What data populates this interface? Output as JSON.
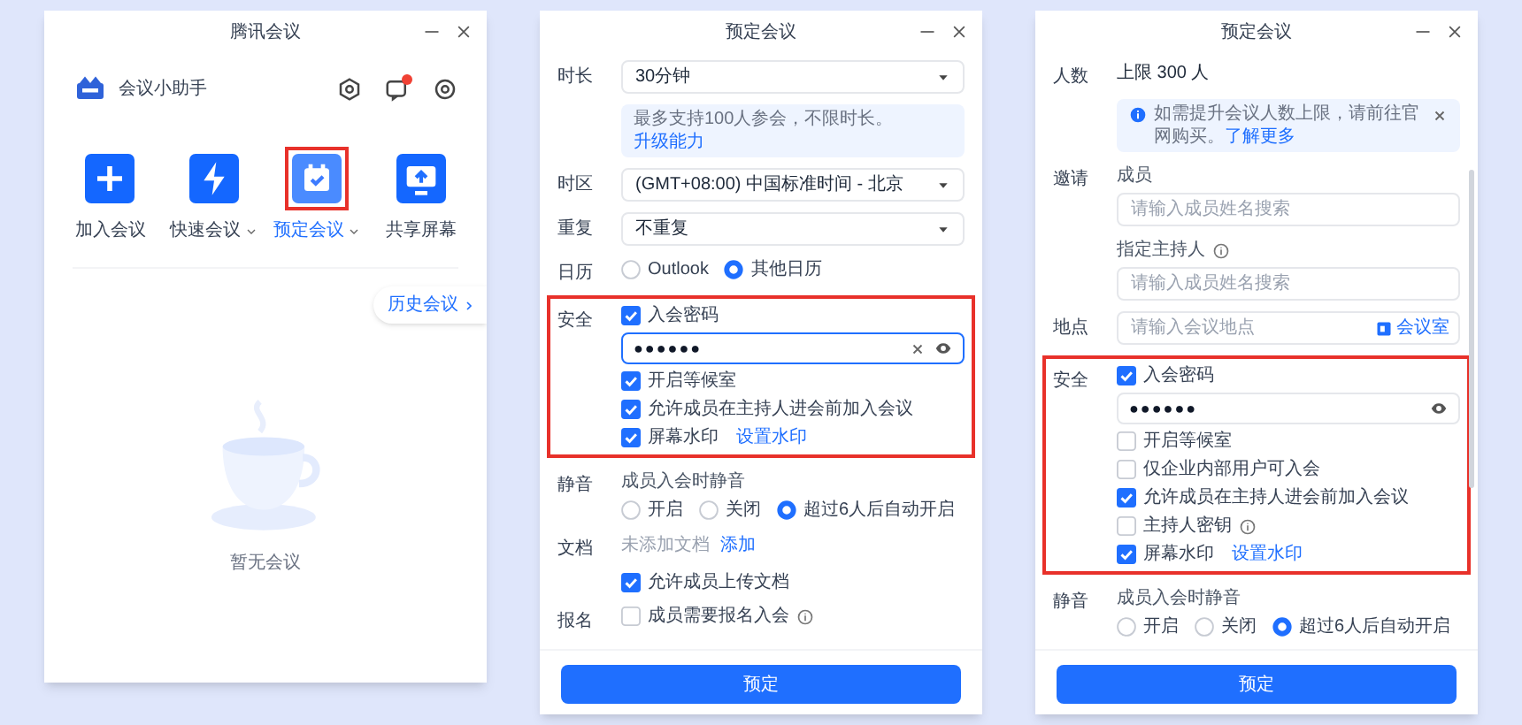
{
  "main_window": {
    "title": "腾讯会议",
    "assistant": "会议小助手",
    "notification_dot": true,
    "actions": [
      {
        "label": "加入会议",
        "selected": false
      },
      {
        "label": "快速会议",
        "dropdown": true,
        "selected": false
      },
      {
        "label": "预定会议",
        "dropdown": true,
        "selected": true
      },
      {
        "label": "共享屏幕",
        "selected": false
      }
    ],
    "history_button": "历史会议",
    "empty_text": "暂无会议"
  },
  "schedule_windows": [
    {
      "title": "预定会议",
      "rows": [
        {
          "kind": "select",
          "label": "时长",
          "value": "30分钟"
        },
        {
          "kind": "notice",
          "text": "最多支持100人参会，不限时长。",
          "link": "升级能力"
        },
        {
          "kind": "select",
          "label": "时区",
          "value": "(GMT+08:00) 中国标准时间 - 北京"
        },
        {
          "kind": "select",
          "label": "重复",
          "value": "不重复"
        },
        {
          "kind": "radios",
          "label": "日历",
          "options": [
            {
              "label": "Outlook",
              "selected": false
            },
            {
              "label": "其他日历",
              "selected": true
            }
          ]
        },
        {
          "kind": "group",
          "label": "安全",
          "highlighted": true,
          "items": [
            {
              "kind": "checkbox",
              "text": "入会密码",
              "checked": true
            },
            {
              "kind": "password",
              "value": "●●●●●●",
              "focused": true,
              "clearable": true
            },
            {
              "kind": "checkbox",
              "text": "开启等候室",
              "checked": true
            },
            {
              "kind": "checkbox",
              "text": "允许成员在主持人进会前加入会议",
              "checked": true
            },
            {
              "kind": "checkbox",
              "text": "屏幕水印",
              "checked": true,
              "link": "设置水印"
            }
          ]
        },
        {
          "kind": "radios",
          "label": "静音",
          "caption": "成员入会时静音",
          "options": [
            {
              "label": "开启",
              "selected": false
            },
            {
              "label": "关闭",
              "selected": false
            },
            {
              "label": "超过6人后自动开启",
              "selected": true
            }
          ]
        },
        {
          "kind": "doc",
          "label": "文档",
          "text": "未添加文档",
          "link": "添加"
        },
        {
          "kind": "checkbox",
          "text": "允许成员上传文档",
          "checked": true
        },
        {
          "kind": "checkbox",
          "label": "报名",
          "text": "成员需要报名入会",
          "checked": false,
          "info": true
        }
      ],
      "button": "预定"
    },
    {
      "title": "预定会议",
      "scrollbar": true,
      "rows": [
        {
          "kind": "plain",
          "label": "人数",
          "value": "上限 300 人"
        },
        {
          "kind": "alert",
          "text": "如需提升会议人数上限，请前往官网购买。",
          "link": "了解更多"
        },
        {
          "kind": "field",
          "label": "邀请",
          "caption": "成员",
          "placeholder": "请输入成员姓名搜索"
        },
        {
          "kind": "field",
          "caption": "指定主持人",
          "info": true,
          "placeholder": "请输入成员姓名搜索"
        },
        {
          "kind": "field",
          "label": "地点",
          "placeholder": "请输入会议地点",
          "button": "会议室"
        },
        {
          "kind": "group",
          "label": "安全",
          "highlighted": true,
          "items": [
            {
              "kind": "checkbox",
              "text": "入会密码",
              "checked": true
            },
            {
              "kind": "password",
              "value": "●●●●●●",
              "focused": false
            },
            {
              "kind": "checkbox",
              "text": "开启等候室",
              "checked": false
            },
            {
              "kind": "checkbox",
              "text": "仅企业内部用户可入会",
              "checked": false
            },
            {
              "kind": "checkbox",
              "text": "允许成员在主持人进会前加入会议",
              "checked": true
            },
            {
              "kind": "checkbox",
              "text": "主持人密钥",
              "checked": false,
              "info": true
            },
            {
              "kind": "checkbox",
              "text": "屏幕水印",
              "checked": true,
              "link": "设置水印"
            }
          ]
        },
        {
          "kind": "radios",
          "label": "静音",
          "caption": "成员入会时静音",
          "options": [
            {
              "label": "开启",
              "selected": false
            },
            {
              "label": "关闭",
              "selected": false
            },
            {
              "label": "超过6人后自动开启",
              "selected": true
            }
          ]
        }
      ],
      "button": "预定"
    }
  ]
}
